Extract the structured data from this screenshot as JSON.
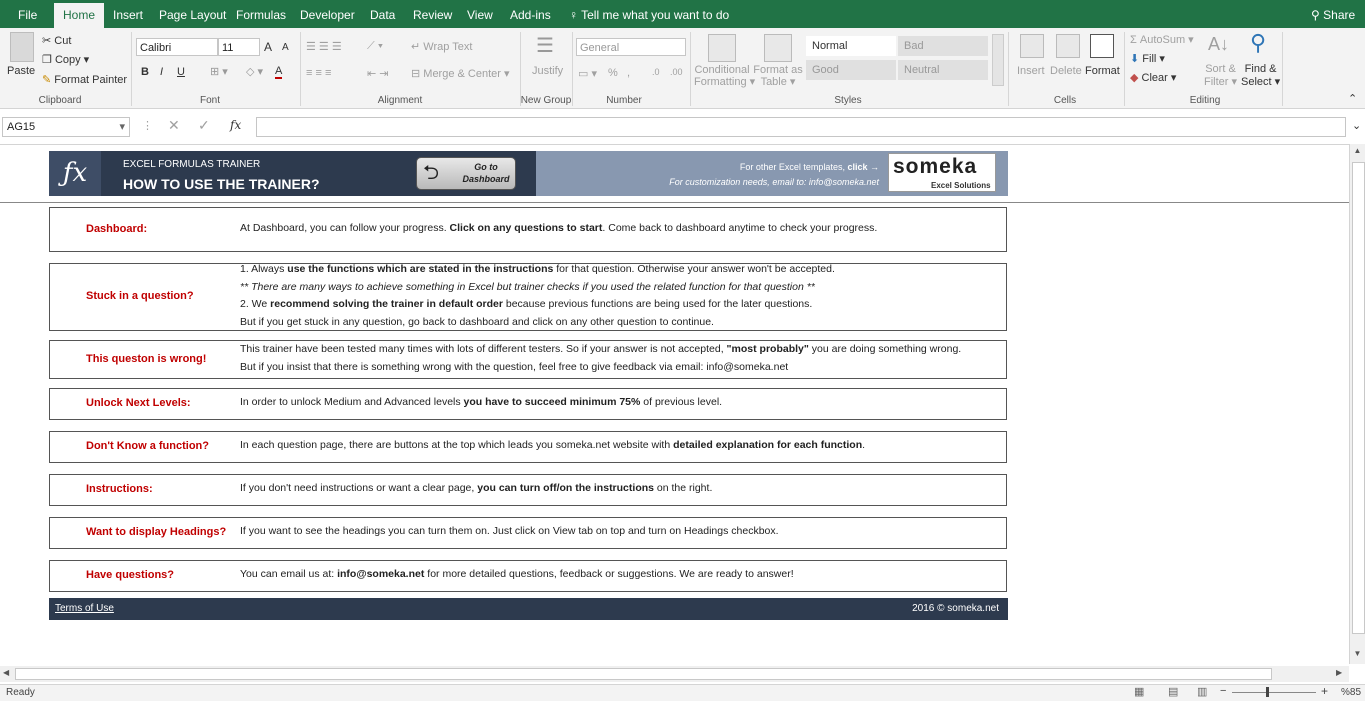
{
  "tabs": [
    "File",
    "Home",
    "Insert",
    "Page Layout",
    "Formulas",
    "Developer",
    "Data",
    "Review",
    "View",
    "Add-ins"
  ],
  "tell_me": "Tell me what you want to do",
  "share": "Share",
  "ribbon": {
    "clipboard": {
      "paste": "Paste",
      "cut": "Cut",
      "copy": "Copy",
      "format_painter": "Format Painter",
      "label": "Clipboard"
    },
    "font": {
      "name": "Calibri",
      "size": "11",
      "bold": "B",
      "italic": "I",
      "underline": "U",
      "grow": "A",
      "shrink": "A",
      "color": "A",
      "label": "Font"
    },
    "alignment": {
      "wrap": "Wrap Text",
      "merge": "Merge & Center",
      "label": "Alignment"
    },
    "new_group": {
      "justify": "Justify",
      "label": "New Group"
    },
    "number": {
      "format": "General",
      "pct": "%",
      "comma": ",",
      "inc": ".0",
      "dec": ".00",
      "label": "Number"
    },
    "styles": {
      "cond1": "Conditional",
      "cond2": "Formatting",
      "fmt1": "Format as",
      "fmt2": "Table",
      "normal": "Normal",
      "bad": "Bad",
      "good": "Good",
      "neutral": "Neutral",
      "label": "Styles"
    },
    "cells": {
      "insert": "Insert",
      "delete": "Delete",
      "format": "Format",
      "label": "Cells"
    },
    "editing": {
      "autosum": "AutoSum",
      "fill": "Fill",
      "clear": "Clear",
      "sort1": "Sort &",
      "sort2": "Filter",
      "find1": "Find &",
      "find2": "Select",
      "label": "Editing"
    }
  },
  "formula_bar": {
    "name_box": "AG15",
    "fx": "fx",
    "value": ""
  },
  "banner": {
    "subtitle": "EXCEL FORMULAS TRAINER",
    "title": "HOW TO USE THE TRAINER?",
    "goto1": "Go to",
    "goto2": "Dashboard",
    "other_text": "For other Excel templates,",
    "click": "click →",
    "custom": "For customization needs, email to: info@someka.net",
    "logo": "someka",
    "logo_sub": "Excel Solutions"
  },
  "cards": [
    {
      "label": "Dashboard:",
      "lines": [
        [
          "At Dashboard, you can follow your progress. ",
          "Click on any questions to start",
          ". Come back to dashboard anytime to check your progress."
        ]
      ]
    },
    {
      "label": "Stuck in a question?",
      "lines": [
        [
          "1. Always ",
          "use the functions which are stated in the instructions",
          " for that question. Otherwise your answer won't be accepted."
        ],
        [
          "** There are many ways to achieve something in Excel but trainer checks if you used the related function for that question **",
          "",
          ""
        ],
        [
          "2. We ",
          "recommend solving the trainer in default order",
          " because previous functions are being used for the later questions."
        ],
        [
          "But if you get stuck in any question, go back to dashboard and click on any other question to continue.",
          "",
          ""
        ]
      ]
    },
    {
      "label": "This queston is wrong!",
      "lines": [
        [
          "This trainer have been tested many times with lots of different testers. So if your answer is not accepted, ",
          "\"most probably\"",
          " you are doing something wrong."
        ],
        [
          "But if you insist that there is something wrong with the question, feel free to give feedback via email: info@someka.net",
          "",
          ""
        ]
      ]
    },
    {
      "label": "Unlock Next Levels:",
      "lines": [
        [
          "In order to unlock Medium and Advanced levels ",
          "you have to succeed minimum 75%",
          " of previous level."
        ]
      ]
    },
    {
      "label": "Don't Know a function?",
      "lines": [
        [
          "In each question page, there are buttons at the top which leads you someka.net website with ",
          "detailed explanation for each function",
          "."
        ]
      ]
    },
    {
      "label": "Instructions:",
      "lines": [
        [
          "If you don't need instructions or want a clear page, ",
          "you can turn off/on the instructions",
          " on the right."
        ]
      ]
    },
    {
      "label": "Want to display Headings?",
      "lines": [
        [
          "If you want to see the headings you can turn them on. Just click on View tab on top and turn on Headings checkbox.",
          "",
          ""
        ]
      ]
    },
    {
      "label": "Have questions?",
      "lines": [
        [
          "You can email us at: ",
          "info@someka.net",
          " for more detailed questions, feedback or suggestions. We are ready to answer!"
        ]
      ]
    }
  ],
  "footer": {
    "terms": "Terms of Use",
    "copyright": "2016 © someka.net"
  },
  "status": {
    "ready": "Ready",
    "zoom": "%85"
  },
  "colors": {
    "excel_green": "#217346",
    "banner_dark": "#2d3a4e",
    "banner_light": "#8898b0",
    "label_red": "#c00000"
  }
}
